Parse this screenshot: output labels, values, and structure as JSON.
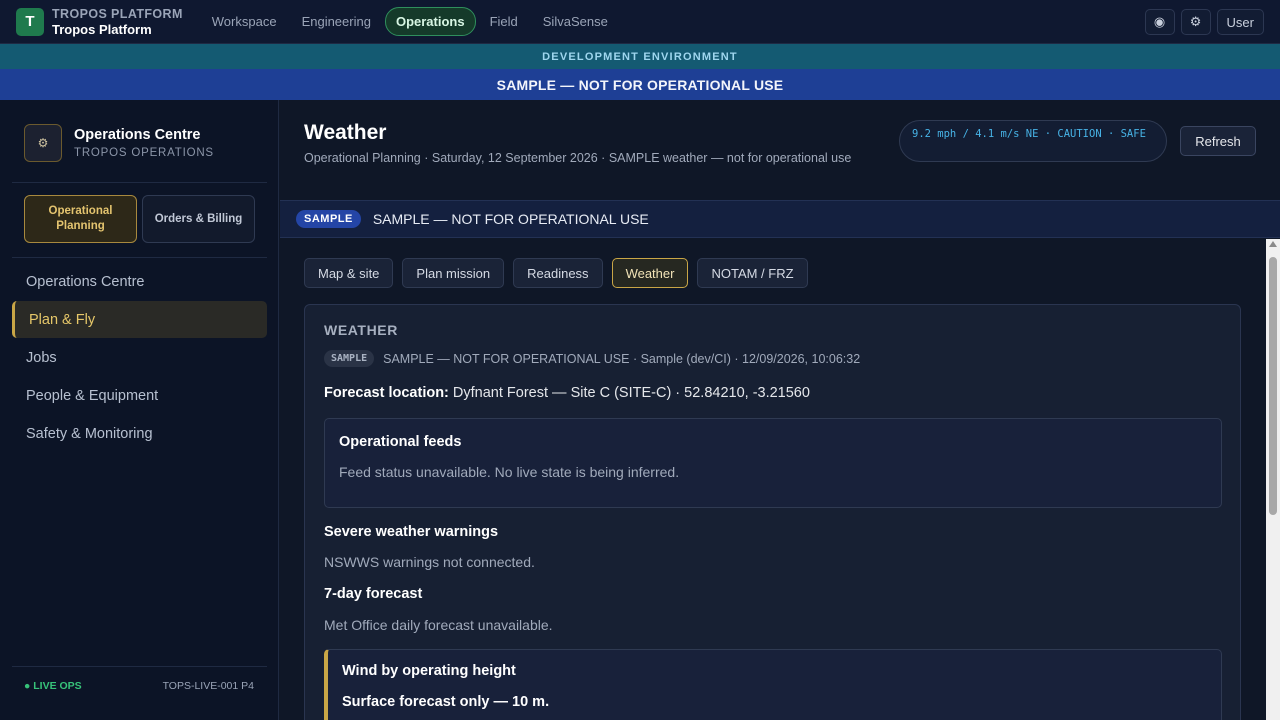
{
  "nav": {
    "logo_letter": "T",
    "brand_upper": "TROPOS PLATFORM",
    "brand_name": "Tropos Platform",
    "links": [
      "Workspace",
      "Engineering",
      "Operations",
      "Field",
      "SilvaSense"
    ],
    "active_link": "Operations",
    "icons": [
      "theme-icon",
      "settings-gear-icon"
    ],
    "theme_glyph": "◉",
    "gear_glyph": "⚙",
    "user_label": "User"
  },
  "banners": {
    "environment": "DEVELOPMENT ENVIRONMENT",
    "sample": "SAMPLE — NOT FOR OPERATIONAL USE"
  },
  "sidebar": {
    "icon_glyph": "⚙",
    "title": "Operations Centre",
    "subtitle": "TROPOS OPERATIONS",
    "modes": [
      "Operational Planning",
      "Orders & Billing"
    ],
    "items": [
      "Operations Centre",
      "Plan & Fly",
      "Jobs",
      "People & Equipment",
      "Safety & Monitoring"
    ],
    "active_item": "Plan & Fly",
    "status": "● LIVE OPS",
    "instance_id": "TOPS-LIVE-001 P4"
  },
  "header": {
    "title": "Weather",
    "subtitle": "Operational Planning · Saturday, 12 September 2026 · SAMPLE weather — not for operational use",
    "wind_chip": "9.2 mph / 4.1 m/s NE · CAUTION · SAFE",
    "refresh_label": "Refresh"
  },
  "sample_strip": {
    "badge": "SAMPLE",
    "text": "SAMPLE — NOT FOR OPERATIONAL USE"
  },
  "tabs": [
    "Map & site",
    "Plan mission",
    "Readiness",
    "Weather",
    "NOTAM / FRZ"
  ],
  "active_tab": "Weather",
  "weather": {
    "heading": "WEATHER",
    "badge": "SAMPLE",
    "meta": "SAMPLE — NOT FOR OPERATIONAL USE · Sample (dev/CI) · 12/09/2026, 10:06:32",
    "location_label": "Forecast location:",
    "location_value": "Dyfnant Forest — Site C (SITE-C) · 52.84210, -3.21560",
    "feeds_title": "Operational feeds",
    "feeds_text": "Feed status unavailable. No live state is being inferred.",
    "warnings_title": "Severe weather warnings",
    "warnings_text": "NSWWS warnings not connected.",
    "forecast_title": "7-day forecast",
    "forecast_text": "Met Office daily forecast unavailable.",
    "wind_title": "Wind by operating height",
    "wind_sub": "Surface forecast only — 10 m."
  }
}
